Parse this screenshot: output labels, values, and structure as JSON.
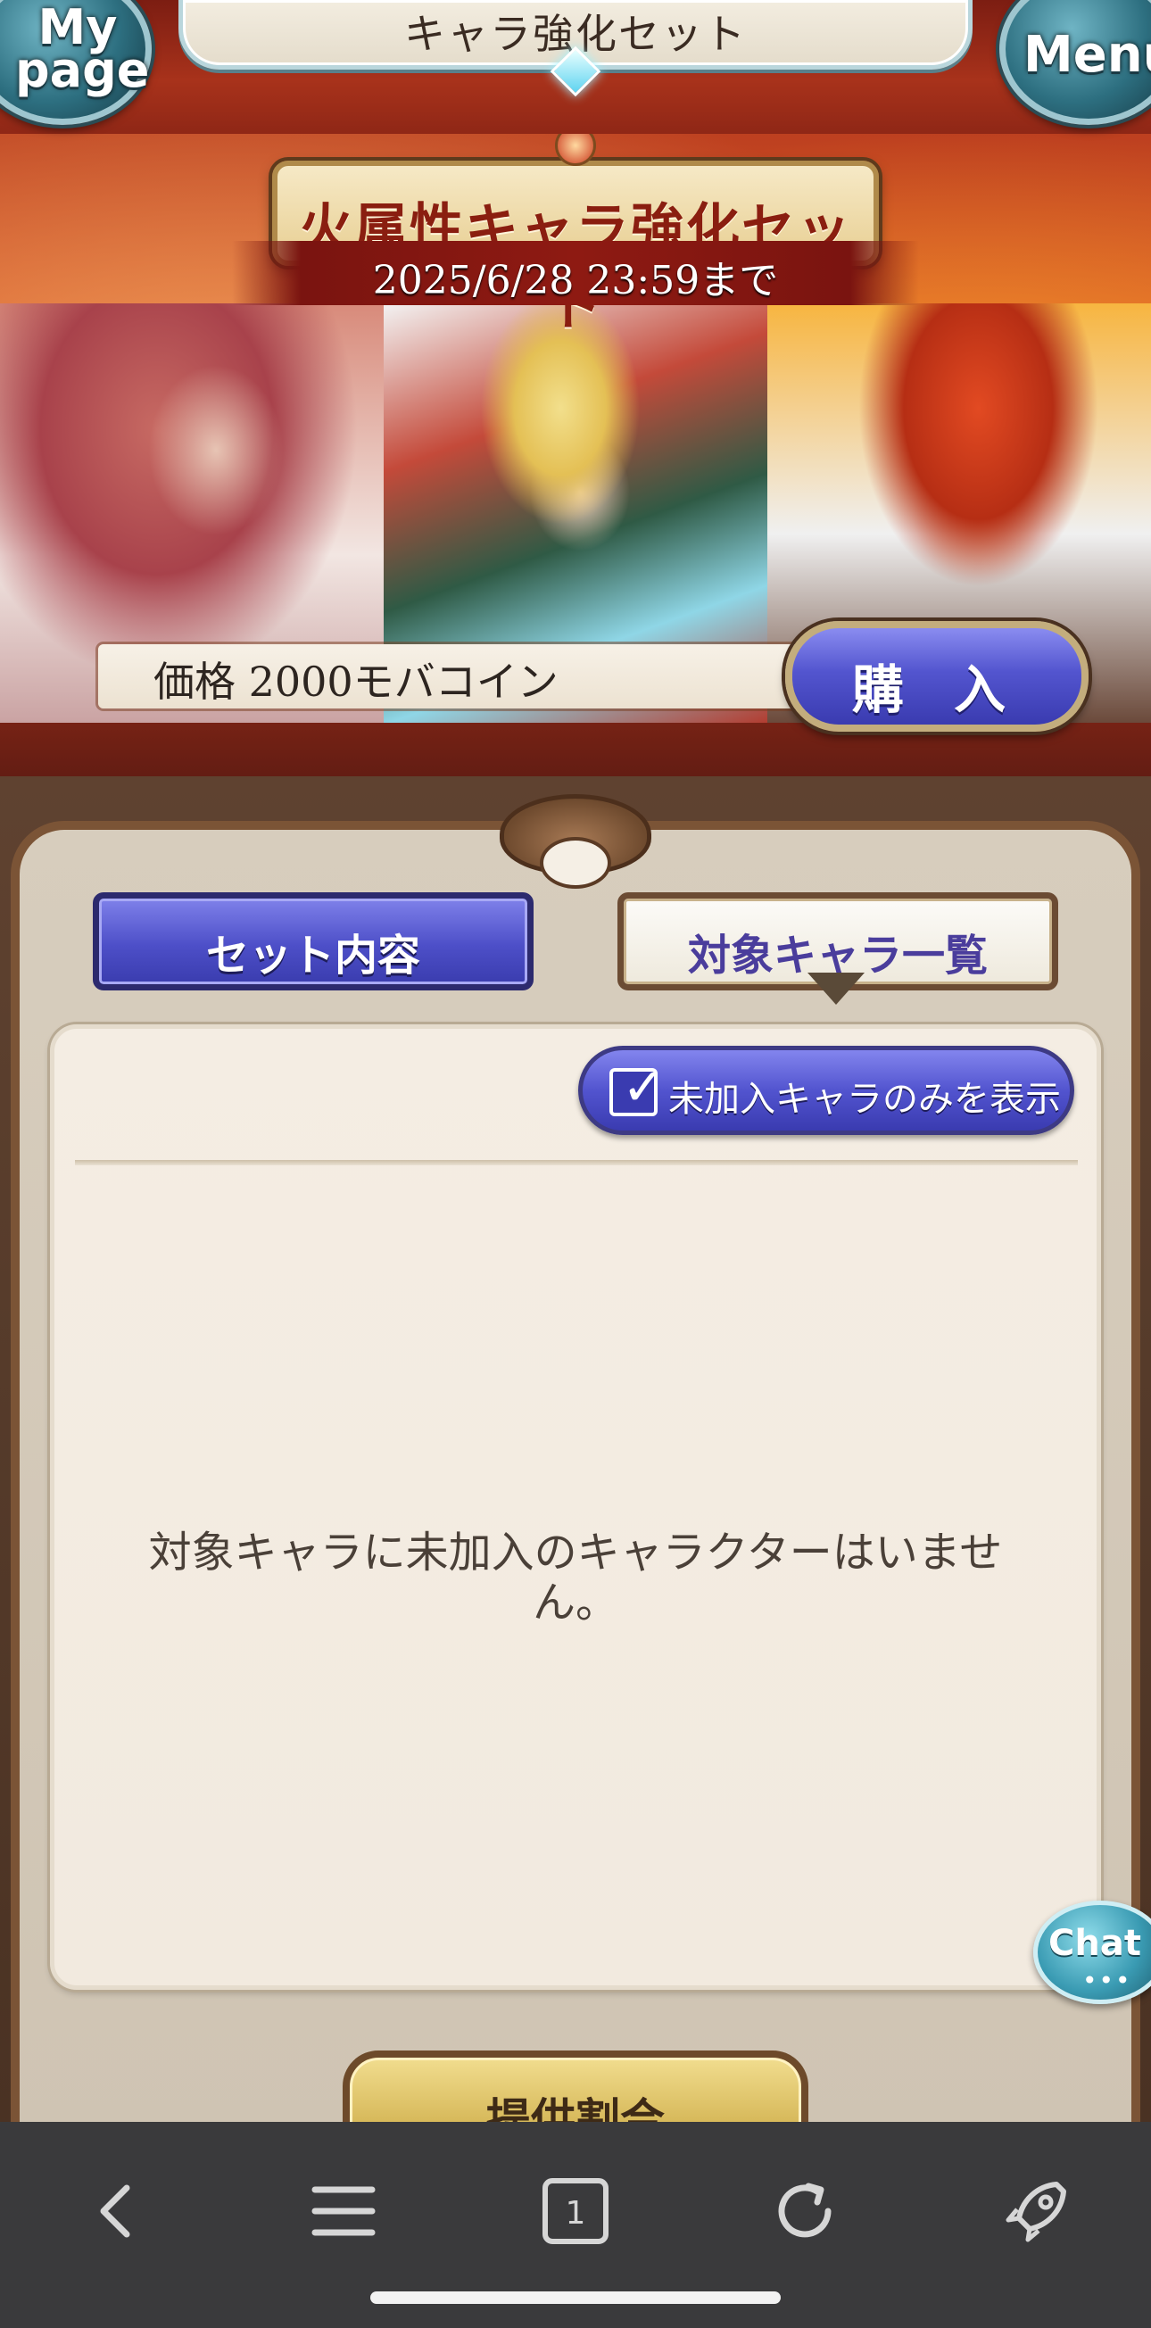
{
  "header": {
    "title": "キャラ強化セット",
    "mypage_label": "My page",
    "menu_label": "Menu"
  },
  "banner": {
    "title": "火属性キャラ強化セット",
    "deadline": "2025/6/28 23:59まで",
    "price": "価格 2000モバコイン",
    "buy_label": "購 入"
  },
  "tabs": {
    "set_contents": "セット内容",
    "target_chars": "対象キャラ一覧",
    "active": "target_chars"
  },
  "panel": {
    "filter_label": "未加入キャラのみを表示",
    "filter_checked": true,
    "empty_message": "対象キャラに未加入のキャラクターはいません。"
  },
  "chat": {
    "label": "Chat",
    "dots": "•••"
  },
  "rate_button": {
    "label": "提供割合"
  },
  "browser_bar": {
    "icons": [
      "back-icon",
      "list-icon",
      "tabs-icon",
      "reload-icon",
      "rocket-icon"
    ],
    "tab_count": "1"
  },
  "colors": {
    "accent_blue": "#5254cf",
    "banner_red": "#a8321b",
    "frame_brown": "#5f4230",
    "panel_bg": "#f4ede3"
  }
}
